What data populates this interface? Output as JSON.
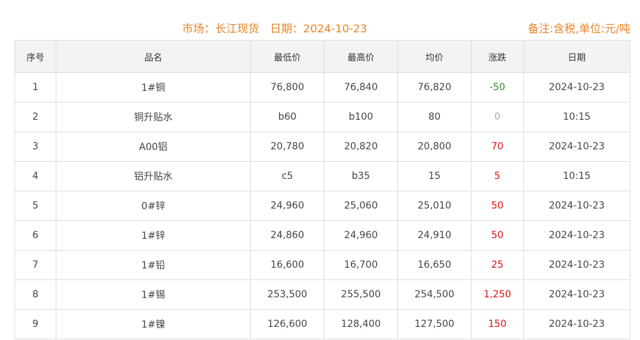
{
  "header": {
    "market_text": "市场：长江现货",
    "date_text": "日期：2024-10-23",
    "note_text": "备注:含税,单位:元/吨"
  },
  "table": {
    "columns": [
      "序号",
      "品名",
      "最低价",
      "最高价",
      "均价",
      "涨跌",
      "日期"
    ],
    "rows": [
      {
        "no": "1",
        "name": "1#铜",
        "low": "76,800",
        "high": "76,840",
        "avg": "76,820",
        "change": "-50",
        "change_color": "#2e8b2e",
        "date": "2024-10-23"
      },
      {
        "no": "2",
        "name": "铜升贴水",
        "low": "b60",
        "high": "b100",
        "avg": "80",
        "change": "0",
        "change_color": "#aaaaaa",
        "date": "10:15"
      },
      {
        "no": "3",
        "name": "A00铝",
        "low": "20,780",
        "high": "20,820",
        "avg": "20,800",
        "change": "70",
        "change_color": "#dd1111",
        "date": "2024-10-23"
      },
      {
        "no": "4",
        "name": "铝升贴水",
        "low": "c5",
        "high": "b35",
        "avg": "15",
        "change": "5",
        "change_color": "#dd1111",
        "date": "10:15"
      },
      {
        "no": "5",
        "name": "0#锌",
        "low": "24,960",
        "high": "25,060",
        "avg": "25,010",
        "change": "50",
        "change_color": "#dd1111",
        "date": "2024-10-23"
      },
      {
        "no": "6",
        "name": "1#锌",
        "low": "24,860",
        "high": "24,960",
        "avg": "24,910",
        "change": "50",
        "change_color": "#dd1111",
        "date": "2024-10-23"
      },
      {
        "no": "7",
        "name": "1#铅",
        "low": "16,600",
        "high": "16,700",
        "avg": "16,650",
        "change": "25",
        "change_color": "#dd1111",
        "date": "2024-10-23"
      },
      {
        "no": "8",
        "name": "1#锡",
        "low": "253,500",
        "high": "255,500",
        "avg": "254,500",
        "change": "1,250",
        "change_color": "#dd1111",
        "date": "2024-10-23"
      },
      {
        "no": "9",
        "name": "1#镍",
        "low": "126,600",
        "high": "128,400",
        "avg": "127,500",
        "change": "150",
        "change_color": "#dd1111",
        "date": "2024-10-23"
      }
    ]
  }
}
